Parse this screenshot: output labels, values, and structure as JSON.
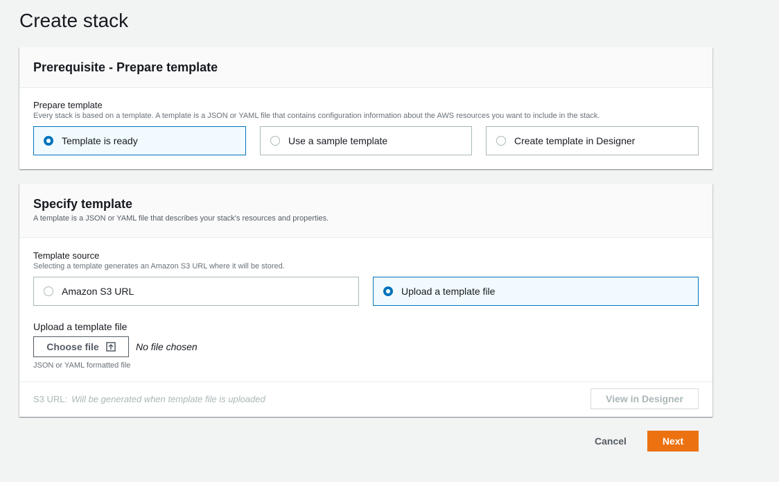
{
  "page": {
    "title": "Create stack"
  },
  "prerequisite": {
    "title": "Prerequisite - Prepare template",
    "field_label": "Prepare template",
    "field_desc": "Every stack is based on a template. A template is a JSON or YAML file that contains configuration information about the AWS resources you want to include in the stack.",
    "options": [
      {
        "label": "Template is ready",
        "selected": true
      },
      {
        "label": "Use a sample template",
        "selected": false
      },
      {
        "label": "Create template in Designer",
        "selected": false
      }
    ]
  },
  "specify": {
    "title": "Specify template",
    "desc": "A template is a JSON or YAML file that describes your stack's resources and properties.",
    "source_label": "Template source",
    "source_desc": "Selecting a template generates an Amazon S3 URL where it will be stored.",
    "options": [
      {
        "label": "Amazon S3 URL",
        "selected": false
      },
      {
        "label": "Upload a template file",
        "selected": true
      }
    ],
    "upload_label": "Upload a template file",
    "choose_file_label": "Choose file",
    "no_file_text": "No file chosen",
    "format_hint": "JSON or YAML formatted file",
    "s3_url_label": "S3 URL:",
    "s3_url_value": "Will be generated when template file is uploaded",
    "view_designer_label": "View in Designer"
  },
  "footer": {
    "cancel_label": "Cancel",
    "next_label": "Next"
  },
  "colors": {
    "accent": "#0073bb",
    "primary_button": "#ec7211",
    "background": "#f2f3f3"
  },
  "icons": [
    "upload-icon"
  ]
}
